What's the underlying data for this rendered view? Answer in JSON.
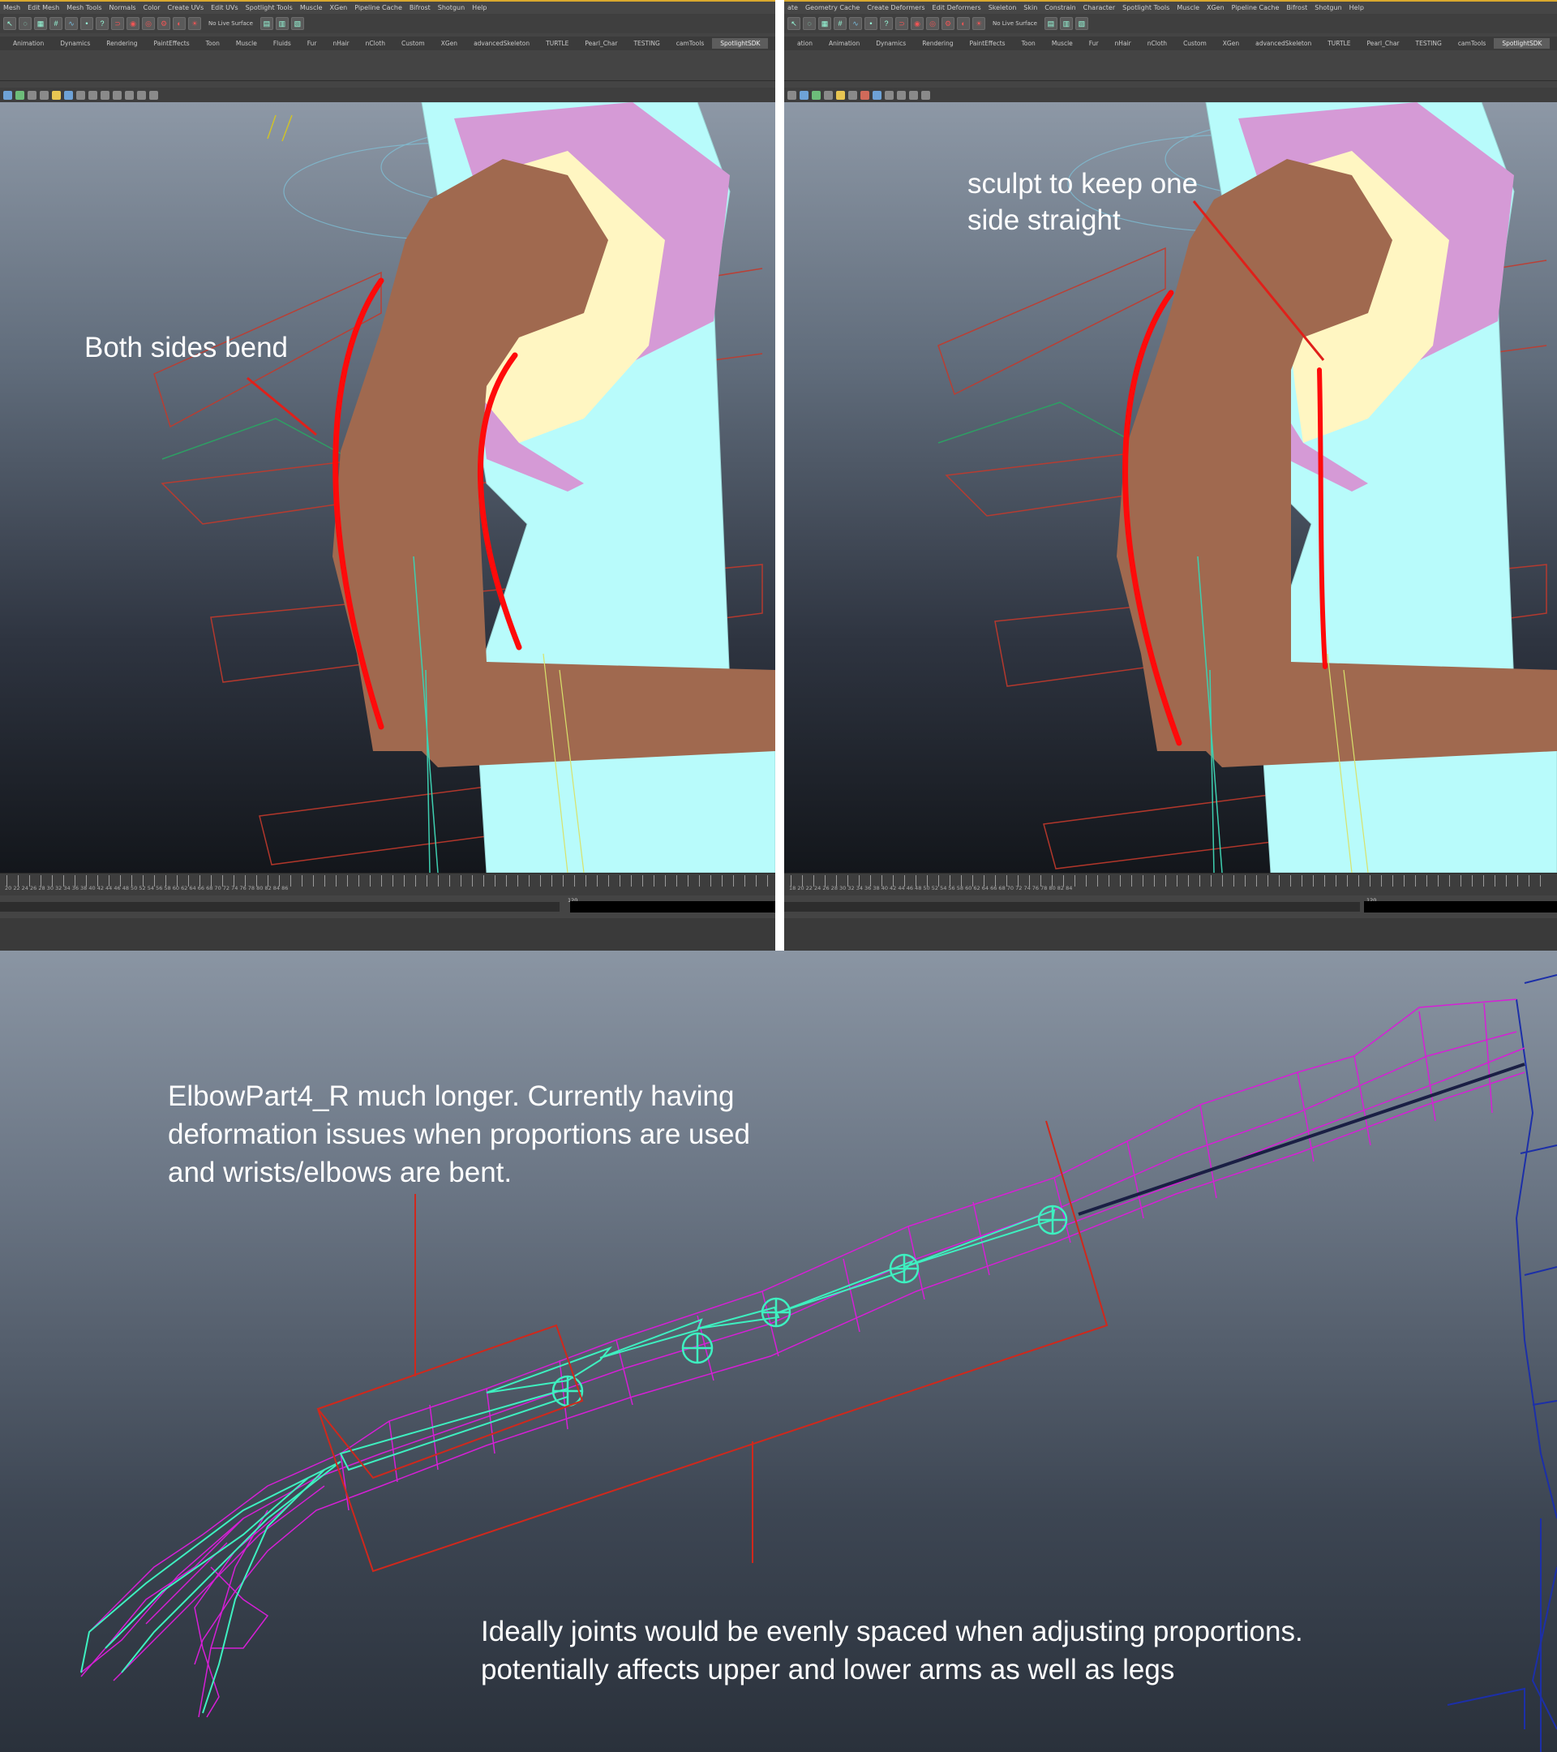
{
  "left_panel": {
    "menu_items": [
      "Mesh",
      "Edit Mesh",
      "Mesh Tools",
      "Normals",
      "Color",
      "Create UVs",
      "Edit UVs",
      "Spotlight Tools",
      "Muscle",
      "XGen",
      "Pipeline Cache",
      "Bifrost",
      "Shotgun",
      "Help"
    ],
    "live_surface_label": "No Live Surface",
    "shelf_tabs": [
      "Animation",
      "Dynamics",
      "Rendering",
      "PaintEffects",
      "Toon",
      "Muscle",
      "Fluids",
      "Fur",
      "nHair",
      "nCloth",
      "Custom",
      "XGen",
      "advancedSkeleton",
      "TURTLE",
      "Pearl_Char",
      "TESTING",
      "camTools",
      "SpotlightSDK"
    ],
    "active_shelf_tab": "SpotlightSDK",
    "annotation": "Both sides bend",
    "timeline_numbers": "20  22  24  26  28  30  32  34  36  38  40  42  44  46  48  50  52  54  56  58  60  62  64  66  68  70  72  74  76  78  80  82  84  86",
    "range_end_label": "120"
  },
  "right_panel": {
    "menu_items": [
      "ate",
      "Geometry Cache",
      "Create Deformers",
      "Edit Deformers",
      "Skeleton",
      "Skin",
      "Constrain",
      "Character",
      "Spotlight Tools",
      "Muscle",
      "XGen",
      "Pipeline Cache",
      "Bifrost",
      "Shotgun",
      "Help"
    ],
    "live_surface_label": "No Live Surface",
    "shelf_tabs": [
      "ation",
      "Animation",
      "Dynamics",
      "Rendering",
      "PaintEffects",
      "Toon",
      "Muscle",
      "Fur",
      "nHair",
      "nCloth",
      "Custom",
      "XGen",
      "advancedSkeleton",
      "TURTLE",
      "Pearl_Char",
      "TESTING",
      "camTools",
      "SpotlightSDK"
    ],
    "active_shelf_tab": "SpotlightSDK",
    "annotation_line1": "sculpt to keep one",
    "annotation_line2": "side straight",
    "timeline_numbers": "18  20  22  24  26  28  30  32  34  36  38  40  42  44  46  48  50  52  54  56  58  60  62  64  66  68  70  72  74  76  78  80  82  84",
    "range_end_label": "120"
  },
  "bottom": {
    "note_top_line1": "ElbowPart4_R much longer.  Currently having",
    "note_top_line2": "deformation  issues when proportions are used",
    "note_top_line3": "and wrists/elbows are bent.",
    "note_bottom_line1": "Ideally joints would be evenly spaced when adjusting proportions.",
    "note_bottom_line2": "potentially affects upper and lower arms as well as legs"
  },
  "colors": {
    "skin": "#a0694f",
    "shirt": "#b8fbfb",
    "lining_yellow": "#fff6c2",
    "lining_pink": "#d59ad6",
    "annotation_red": "#ff0a0a",
    "wireframe": "#d61fd6",
    "joints": "#3ef0c0",
    "menu_accent": "#d9a82d"
  }
}
